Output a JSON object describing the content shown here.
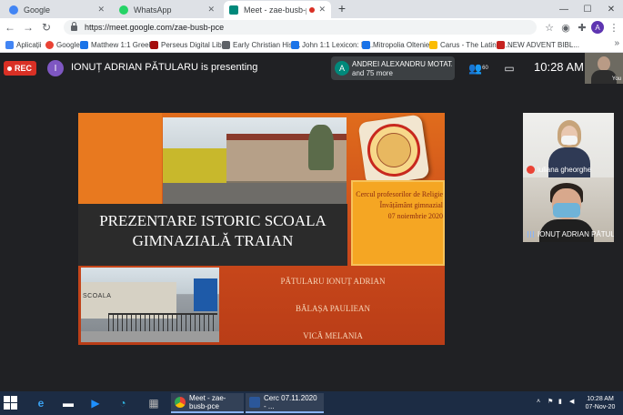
{
  "tabs": [
    {
      "label": "Google",
      "icon": "google-icon",
      "color": "#4285f4"
    },
    {
      "label": "WhatsApp",
      "icon": "whatsapp-icon",
      "color": "#25d366"
    },
    {
      "label": "Meet - zae-busb-pce",
      "icon": "meet-icon",
      "color": "#00897b"
    }
  ],
  "url": "https://meet.google.com/zae-busb-pce",
  "profile_initial": "A",
  "bookmarks": [
    {
      "label": "Aplicații",
      "color": "#4285f4"
    },
    {
      "label": "Google",
      "color": "#ea4335"
    },
    {
      "label": "Matthew 1:1 Greek...",
      "color": "#1a73e8"
    },
    {
      "label": "Perseus Digital Libr...",
      "color": "#a50e0e"
    },
    {
      "label": "Early Christian Hist...",
      "color": "#5f6368"
    },
    {
      "label": "John 1:1 Lexicon: In...",
      "color": "#1a73e8"
    },
    {
      "label": "Mitropolia Olteniei",
      "color": "#1a73e8"
    },
    {
      "label": "Carus - The Latin Di...",
      "color": "#fbbc04"
    },
    {
      "label": "NEW ADVENT BIBL...",
      "color": "#c5221f"
    }
  ],
  "meeting": {
    "rec_label": "REC",
    "presenter_initial": "I",
    "presenter_text": "IONUȚ ADRIAN PĂTULARU is presenting",
    "participant_initial": "A",
    "participant_name": "ANDREI ALEXANDRU MOTATAE...",
    "participant_more": "and 75 more",
    "people_count": "60",
    "time": "10:28 AM",
    "self_label": "You"
  },
  "slide": {
    "title_line1": "PREZENTARE ISTORIC SCOALA",
    "title_line2": "GIMNAZIALĂ TRAIAN",
    "info_line1": "Cercul profesorilor de Religie",
    "info_line2": "Învățământ gimnazial",
    "info_line3": "07 noiembrie 2020",
    "names": [
      "PĂTULARU IONUȚ ADRIAN",
      "BĂLAȘA PAULIEAN",
      "VICĂ MELANIA"
    ],
    "photo_label": "SCOALA"
  },
  "tiles": [
    {
      "name": "iuliana gheorghe"
    },
    {
      "name": "IONUȚ ADRIAN PĂTULA..."
    }
  ],
  "taskbar": {
    "apps": [
      {
        "label": "Meet - zae-busb-pce",
        "color": "#4285f4"
      },
      {
        "label": "Cerc 07.11.2020 - ...",
        "color": "#2b579a"
      }
    ],
    "time": "10:28 AM",
    "date": "07-Nov-20"
  }
}
